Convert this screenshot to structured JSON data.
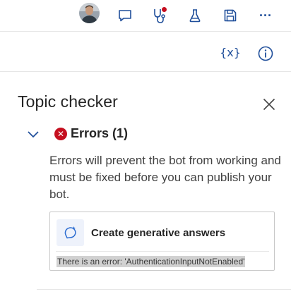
{
  "topbar": {
    "icons": [
      "avatar",
      "comment-icon",
      "stethoscope-icon",
      "flask-icon",
      "save-icon",
      "more-icon"
    ],
    "more_label": "···",
    "notification_color": "#c50f1f"
  },
  "toolbar": {
    "variables_label": "{x}",
    "info_icon": "info-icon"
  },
  "panel": {
    "title": "Topic checker",
    "close_icon": "close-icon",
    "errors_header": "Errors (1)",
    "errors_icon_glyph": "✕",
    "description": "Errors will prevent the bot from working and must be fixed before you can publish your bot.",
    "card": {
      "title": "Create generative answers",
      "error_text": "There is an error: 'AuthenticationInputNotEnabled'"
    }
  },
  "colors": {
    "accent": "#1f4e9a",
    "error": "#c50f1f",
    "icon_blue": "#2b6cd1"
  }
}
